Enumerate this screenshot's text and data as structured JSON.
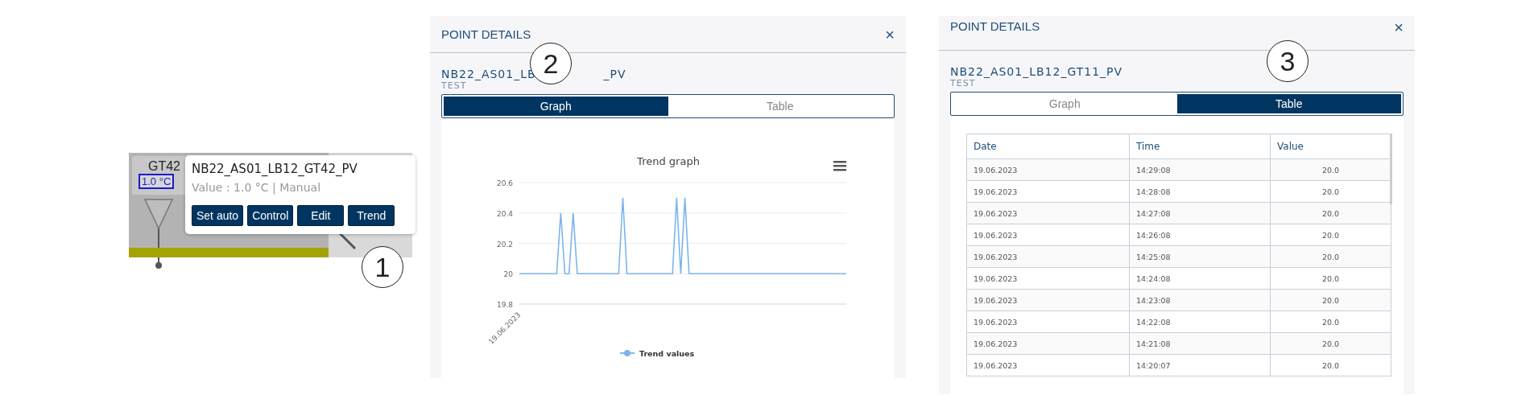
{
  "plant_widget": {
    "label": "GT42",
    "reading": "1.0 °C"
  },
  "tooltip": {
    "point": "NB22_AS01_LB12_GT42_PV",
    "status": "Value : 1.0 °C | Manual",
    "buttons": [
      "Set auto",
      "Control",
      "Edit",
      "Trend"
    ]
  },
  "graph_panel": {
    "title": "POINT DETAILS",
    "close": "×",
    "point": "NB22_AS01_LB",
    "point_end": "_PV",
    "subtitle": "TEST",
    "tabs": [
      {
        "label": "Graph",
        "selected": true
      },
      {
        "label": "Table",
        "selected": false
      }
    ],
    "chart_data": {
      "type": "line",
      "title": "Trend graph",
      "ylim": [
        19.8,
        20.6
      ],
      "yticks": [
        19.8,
        20,
        20.2,
        20.4,
        20.6
      ],
      "annotations": [
        {
          "text": "19.06.2023"
        }
      ],
      "grid": true,
      "series": [
        {
          "name": "Trend values",
          "color": "#7cb5ec",
          "values": [
            20,
            20,
            20,
            20,
            20,
            20,
            20,
            20,
            20,
            20,
            20.4,
            20,
            20,
            20.4,
            20,
            20,
            20,
            20,
            20,
            20,
            20,
            20,
            20,
            20,
            20,
            20.5,
            20,
            20,
            20,
            20,
            20,
            20,
            20,
            20,
            20,
            20,
            20,
            20,
            20.5,
            20,
            20.5,
            20,
            20,
            20,
            20,
            20,
            20,
            20,
            20,
            20,
            20,
            20,
            20,
            20,
            20,
            20,
            20,
            20,
            20,
            20,
            20,
            20,
            20,
            20,
            20,
            20,
            20,
            20,
            20,
            20,
            20,
            20,
            20,
            20,
            20,
            20,
            20,
            20,
            20,
            20
          ]
        }
      ]
    }
  },
  "table_panel": {
    "title": "POINT DETAILS",
    "close": "×",
    "point": "NB22_AS01_LB12_GT11_PV",
    "subtitle": "TEST",
    "tabs": [
      {
        "label": "Graph",
        "selected": false
      },
      {
        "label": "Table",
        "selected": true
      }
    ],
    "columns": [
      "Date",
      "Time",
      "Value"
    ],
    "rows": [
      [
        "19.06.2023",
        "14:29:08",
        "20.0"
      ],
      [
        "19.06.2023",
        "14:28:08",
        "20.0"
      ],
      [
        "19.06.2023",
        "14:27:08",
        "20.0"
      ],
      [
        "19.06.2023",
        "14:26:08",
        "20.0"
      ],
      [
        "19.06.2023",
        "14:25:08",
        "20.0"
      ],
      [
        "19.06.2023",
        "14:24:08",
        "20.0"
      ],
      [
        "19.06.2023",
        "14:23:08",
        "20.0"
      ],
      [
        "19.06.2023",
        "14:22:08",
        "20.0"
      ],
      [
        "19.06.2023",
        "14:21:08",
        "20.0"
      ],
      [
        "19.06.2023",
        "14:20:07",
        "20.0"
      ]
    ]
  },
  "callouts": [
    "1",
    "2",
    "3"
  ]
}
